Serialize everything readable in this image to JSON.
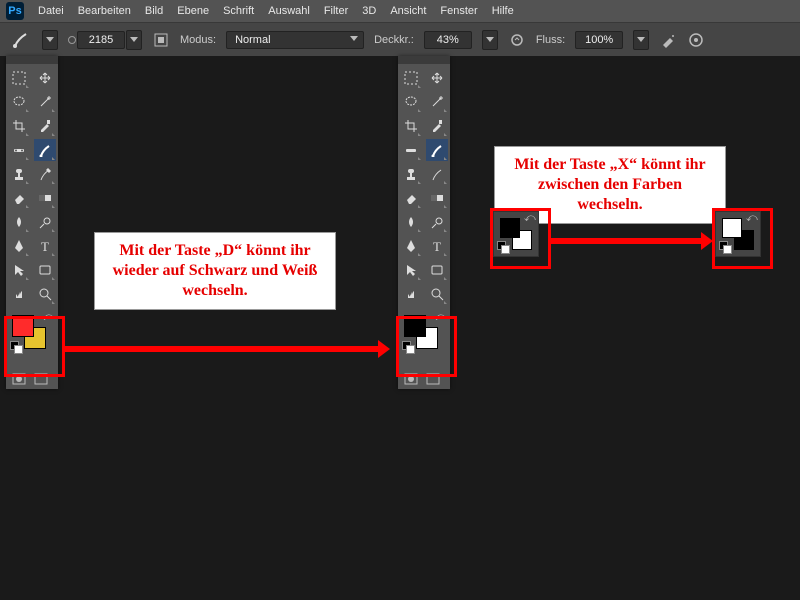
{
  "menu": {
    "items": [
      "Datei",
      "Bearbeiten",
      "Bild",
      "Ebene",
      "Schrift",
      "Auswahl",
      "Filter",
      "3D",
      "Ansicht",
      "Fenster",
      "Hilfe"
    ]
  },
  "options": {
    "brush_size": "2185",
    "mode_label": "Modus:",
    "mode_value": "Normal",
    "opacity_label": "Deckkr.:",
    "opacity_value": "43%",
    "flow_label": "Fluss:",
    "flow_value": "100%"
  },
  "toolpanel1": {
    "fg": "#ff2b2b",
    "bg": "#e6c32e"
  },
  "toolpanel2": {
    "fg": "#000000",
    "bg": "#ffffff"
  },
  "callouts": {
    "d": "Mit der Taste „D“ könnt ihr wieder auf Schwarz und Weiß wechseln.",
    "x": "Mit der Taste „X“ könnt ihr zwischen den Farben wechseln."
  }
}
